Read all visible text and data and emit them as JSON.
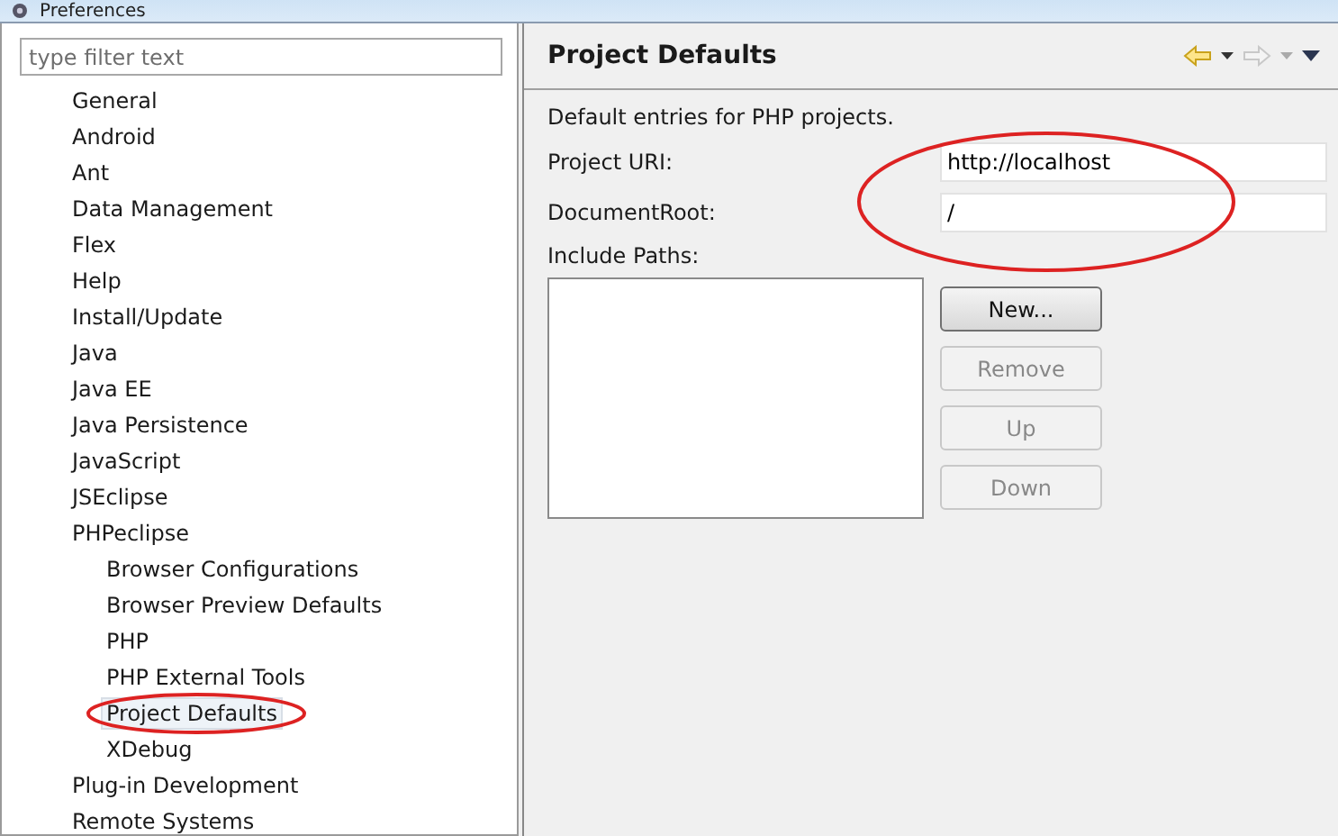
{
  "window": {
    "title": "Preferences"
  },
  "filter": {
    "placeholder": "type filter text"
  },
  "tree": [
    {
      "label": "General",
      "selected": false
    },
    {
      "label": "Android",
      "selected": false
    },
    {
      "label": "Ant",
      "selected": false
    },
    {
      "label": "Data Management",
      "selected": false
    },
    {
      "label": "Flex",
      "selected": false
    },
    {
      "label": "Help",
      "selected": false
    },
    {
      "label": "Install/Update",
      "selected": false
    },
    {
      "label": "Java",
      "selected": false
    },
    {
      "label": "Java EE",
      "selected": false
    },
    {
      "label": "Java Persistence",
      "selected": false
    },
    {
      "label": "JavaScript",
      "selected": false
    },
    {
      "label": "JSEclipse",
      "selected": false
    },
    {
      "label": "PHPeclipse",
      "selected": false,
      "children": [
        {
          "label": "Browser Configurations",
          "selected": false
        },
        {
          "label": "Browser Preview Defaults",
          "selected": false
        },
        {
          "label": "PHP",
          "selected": false
        },
        {
          "label": "PHP External Tools",
          "selected": false
        },
        {
          "label": "Project Defaults",
          "selected": true
        },
        {
          "label": "XDebug",
          "selected": false
        }
      ]
    },
    {
      "label": "Plug-in Development",
      "selected": false
    },
    {
      "label": "Remote Systems",
      "selected": false
    }
  ],
  "page": {
    "title": "Project Defaults",
    "description": "Default entries for PHP projects.",
    "fields": [
      {
        "label": "Project URI:",
        "value": "http://localhost"
      },
      {
        "label": "DocumentRoot:",
        "value": "/"
      }
    ],
    "include_paths_label": "Include Paths:",
    "buttons": [
      {
        "label": "New...",
        "disabled": false
      },
      {
        "label": "Remove",
        "disabled": true
      },
      {
        "label": "Up",
        "disabled": true
      },
      {
        "label": "Down",
        "disabled": true
      }
    ]
  }
}
